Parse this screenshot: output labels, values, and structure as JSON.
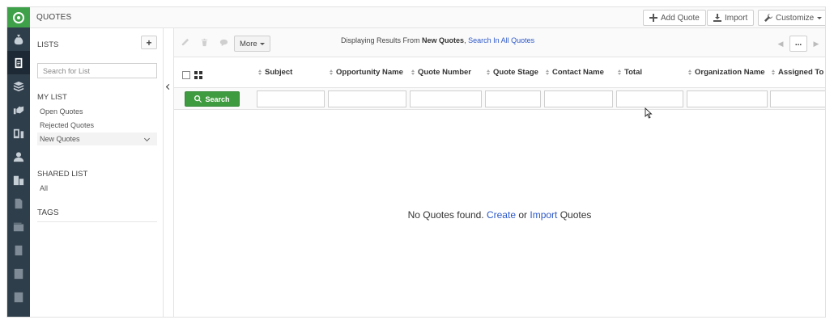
{
  "app": {
    "page_title": "QUOTES",
    "accent_color": "#3fa04a",
    "rail_color": "#2f3e4b"
  },
  "rail": {
    "items": [
      {
        "icon": "money-bag-icon"
      },
      {
        "icon": "quotes-icon",
        "active": true
      },
      {
        "icon": "box-icon"
      },
      {
        "icon": "handshake-icon"
      },
      {
        "icon": "devices-icon"
      },
      {
        "icon": "person-icon"
      },
      {
        "icon": "building-icon"
      },
      {
        "icon": "document-icon"
      },
      {
        "icon": "wallet-icon"
      },
      {
        "icon": "signed-file-icon"
      },
      {
        "icon": "contact-card-icon"
      },
      {
        "icon": "office-icon"
      }
    ]
  },
  "header": {
    "add_quote": "Add Quote",
    "import": "Import",
    "customize": "Customize"
  },
  "lists": {
    "title": "LISTS",
    "add_label": "+",
    "search_placeholder": "Search for List",
    "my_list_label": "MY LIST",
    "my_list_items": [
      "Open Quotes",
      "Rejected Quotes",
      "New Quotes"
    ],
    "shared_list_label": "SHARED LIST",
    "shared_list_items": [
      "All"
    ],
    "tags_label": "TAGS"
  },
  "actions": {
    "more_label": "More",
    "results_prefix": "Displaying Results From",
    "results_list": "New Quotes",
    "results_link": "Search In All Quotes",
    "pager_more": "..."
  },
  "table": {
    "columns": [
      "Subject",
      "Opportunity Name",
      "Quote Number",
      "Quote Stage",
      "Contact Name",
      "Total",
      "Organization Name",
      "Assigned To"
    ],
    "search_label": "Search"
  },
  "empty": {
    "prefix": "No Quotes found.",
    "create": "Create",
    "or": "or",
    "import": "Import",
    "suffix": "Quotes"
  }
}
